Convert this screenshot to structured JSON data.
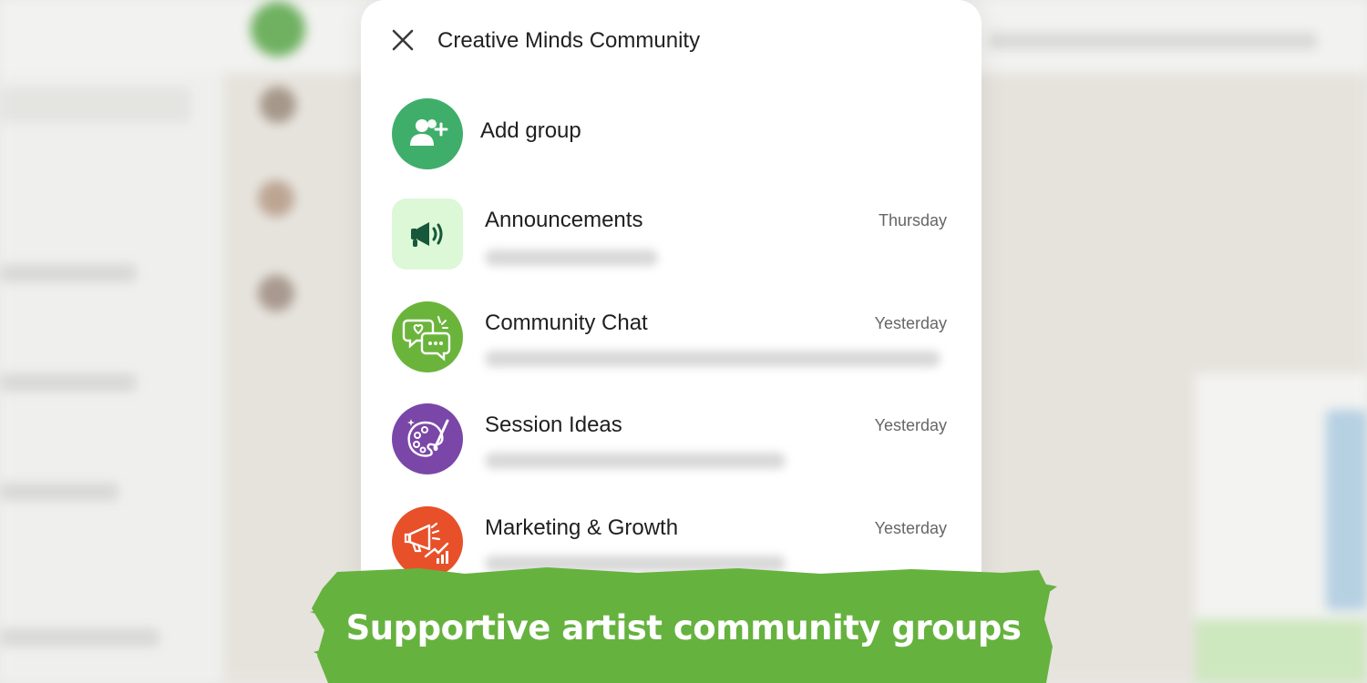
{
  "modal": {
    "title": "Creative Minds Community",
    "add_group_label": "Add group"
  },
  "groups": [
    {
      "name": "Announcements",
      "time": "Thursday",
      "icon": "megaphone-icon"
    },
    {
      "name": "Community Chat",
      "time": "Yesterday",
      "icon": "chat-bubbles-icon"
    },
    {
      "name": "Session Ideas",
      "time": "Yesterday",
      "icon": "palette-icon"
    },
    {
      "name": "Marketing & Growth",
      "time": "Yesterday",
      "icon": "megaphone-growth-icon"
    }
  ],
  "caption": "Supportive artist community groups",
  "colors": {
    "accent_green": "#3fae6a",
    "announce_bg": "#dcf8d6",
    "chat_green": "#6bb43c",
    "session_purple": "#7a47a8",
    "marketing_orange": "#e8502a",
    "banner_green": "#66b23f"
  }
}
